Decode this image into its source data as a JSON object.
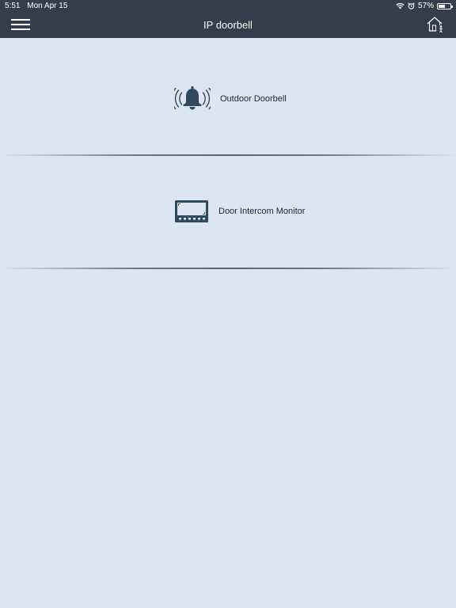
{
  "status_bar": {
    "time": "5:51",
    "date": "Mon Apr 15",
    "battery_percent": "57%",
    "battery_level": 0.57
  },
  "header": {
    "title": "IP doorbell"
  },
  "devices": [
    {
      "label": "Outdoor Doorbell",
      "icon": "bell-ringing-icon"
    },
    {
      "label": "Door Intercom Monitor",
      "icon": "intercom-monitor-icon"
    }
  ],
  "colors": {
    "header_bg": "#333d4b",
    "page_bg": "#dce5f2",
    "icon": "#2f4a5c"
  }
}
